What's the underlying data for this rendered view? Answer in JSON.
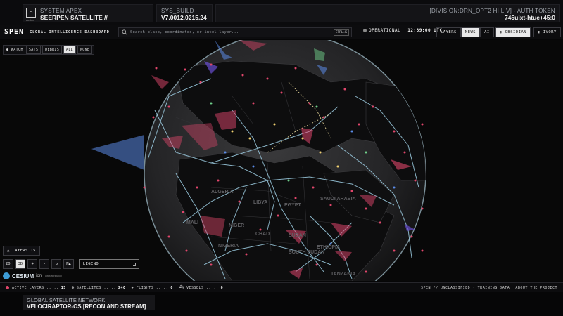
{
  "banner": {
    "logo_sub": "Action",
    "system_line1": "SYSTEM APEX",
    "system_line2": "SEERPEN SATELLITE //",
    "build_line1": "SYS_BUILD",
    "build_line2": "V7.0012.0215.24",
    "auth_line1": "[DIVISION:DRN_OPT2 HI.LIV] - AUTH TOKEN",
    "auth_line2": "745uixt-htue+45:0"
  },
  "header": {
    "brand": "SPEN",
    "subtitle": "GLOBAL INTELLIGENCE DASHBOARD",
    "search_placeholder": "Search place, coordinates, or intel layer...",
    "search_shortcut": "CTRL+K",
    "status": "OPERATIONAL",
    "time": "12:39:00 UTC",
    "tabs": [
      {
        "label": "LAYERS",
        "active": false
      },
      {
        "label": "NEWS",
        "active": true
      },
      {
        "label": "AI",
        "active": false
      }
    ],
    "themes": [
      {
        "label": "OBSIDIAN",
        "icon": "◐",
        "active": true
      },
      {
        "label": "IVORY",
        "icon": "◐",
        "active": false
      }
    ]
  },
  "watch": {
    "label": "WATCH",
    "buttons": [
      {
        "label": "SATS",
        "active": false
      },
      {
        "label": "DEBRIS",
        "active": false
      },
      {
        "label": "ALL",
        "active": true
      },
      {
        "label": "NONE",
        "active": false
      }
    ]
  },
  "map": {
    "country_labels": [
      "ALGERIA",
      "LIBYA",
      "EGYPT",
      "SAUDI ARABIA",
      "NIGER",
      "CHAD",
      "SUDAN",
      "NIGERIA",
      "SOUTH SUDAN",
      "ETHIOPIA",
      "MALI",
      "TANZANIA"
    ],
    "accent_colors": {
      "pink": "#e0466b",
      "blue": "#5b8be6",
      "green": "#6fcf8a",
      "purple": "#6a4fd1",
      "track": "#9fd0e6"
    }
  },
  "controls": {
    "layers_label": "LAYERS 15",
    "view_2d": "2D",
    "view_3d": "3D",
    "zoom_in": "+",
    "zoom_out": "-",
    "reset_icon": "↻",
    "north_label": "N▲",
    "legend_label": "LEGEND"
  },
  "attribution": {
    "brand": "CESIUM",
    "sub": "ion",
    "credits": "Data attribution"
  },
  "statusbar": {
    "active_layers_label": "ACTIVE LAYERS :: ::",
    "active_layers_value": "15",
    "satellites_label": "SATELLITES :: ::",
    "satellites_value": "240",
    "flights_label": "FLIGHTS :: ::",
    "flights_value": "0",
    "vessels_label": "VESSELS :: ::",
    "vessels_value": "0",
    "right_items": [
      "SPEN // UNCLASSIFIED · TRAINING DATA",
      "ABOUT THE PROJECT"
    ]
  },
  "caption": {
    "line1": "GLOBAL SATELLITE NETWORK",
    "line2": "VELOCIRAPTOR-OS [RECON AND STREAM]"
  }
}
